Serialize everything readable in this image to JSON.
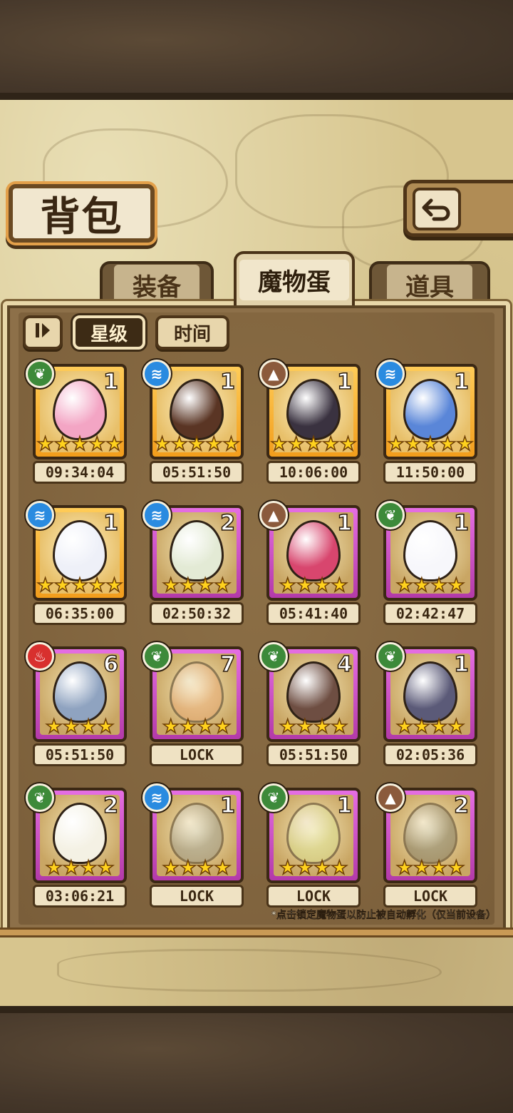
{
  "title": "背包",
  "back_icon": "back-arrow-icon",
  "tabs": [
    {
      "label": "装备",
      "active": false
    },
    {
      "label": "魔物蛋",
      "active": true
    },
    {
      "label": "道具",
      "active": false
    }
  ],
  "sort": {
    "toggle_icon": "sort-order-icon",
    "star_label": "星级",
    "time_label": "时间",
    "active": "星级"
  },
  "element_icons": {
    "grass": "leaf-icon",
    "water": "water-wave-icon",
    "earth": "mountain-icon",
    "fire": "flame-icon"
  },
  "eggs": [
    {
      "element": "grass",
      "count": "1",
      "stars": 5,
      "frame": "gold",
      "timer": "09:34:04",
      "color": "#f3a5c4"
    },
    {
      "element": "water",
      "count": "1",
      "stars": 5,
      "frame": "gold",
      "timer": "05:51:50",
      "color": "#5a3524"
    },
    {
      "element": "earth",
      "count": "1",
      "stars": 5,
      "frame": "gold",
      "timer": "10:06:00",
      "color": "#3a3240"
    },
    {
      "element": "water",
      "count": "1",
      "stars": 5,
      "frame": "gold",
      "timer": "11:50:00",
      "color": "#5a86d8"
    },
    {
      "element": "water",
      "count": "1",
      "stars": 5,
      "frame": "gold",
      "timer": "06:35:00",
      "color": "#eef0f8"
    },
    {
      "element": "water",
      "count": "2",
      "stars": 4,
      "frame": "purple",
      "timer": "02:50:32",
      "color": "#e3ead5"
    },
    {
      "element": "earth",
      "count": "1",
      "stars": 4,
      "frame": "purple",
      "timer": "05:41:40",
      "color": "#d8466e"
    },
    {
      "element": "grass",
      "count": "1",
      "stars": 4,
      "frame": "purple",
      "timer": "02:42:47",
      "color": "#f7f7fb"
    },
    {
      "element": "fire",
      "count": "6",
      "stars": 4,
      "frame": "purple",
      "timer": "05:51:50",
      "color": "#8fa3c0"
    },
    {
      "element": "grass",
      "count": "7",
      "stars": 4,
      "frame": "purple",
      "timer": "LOCK",
      "color": "#e8a06a",
      "locked": true
    },
    {
      "element": "grass",
      "count": "4",
      "stars": 4,
      "frame": "purple",
      "timer": "05:51:50",
      "color": "#6e4e42"
    },
    {
      "element": "grass",
      "count": "1",
      "stars": 4,
      "frame": "purple",
      "timer": "02:05:36",
      "color": "#5b5a78"
    },
    {
      "element": "grass",
      "count": "2",
      "stars": 4,
      "frame": "purple",
      "timer": "03:06:21",
      "color": "#f4f1e4"
    },
    {
      "element": "water",
      "count": "1",
      "stars": 4,
      "frame": "purple",
      "timer": "LOCK",
      "color": "#8d8f88",
      "locked": true
    },
    {
      "element": "grass",
      "count": "1",
      "stars": 4,
      "frame": "purple",
      "timer": "LOCK",
      "color": "#d8e28c",
      "locked": true
    },
    {
      "element": "earth",
      "count": "2",
      "stars": 4,
      "frame": "purple",
      "timer": "LOCK",
      "color": "#6d6a5a",
      "locked": true
    }
  ],
  "hint": "*点击锁定魔物蛋以防止被自动孵化（仅当前设备）"
}
